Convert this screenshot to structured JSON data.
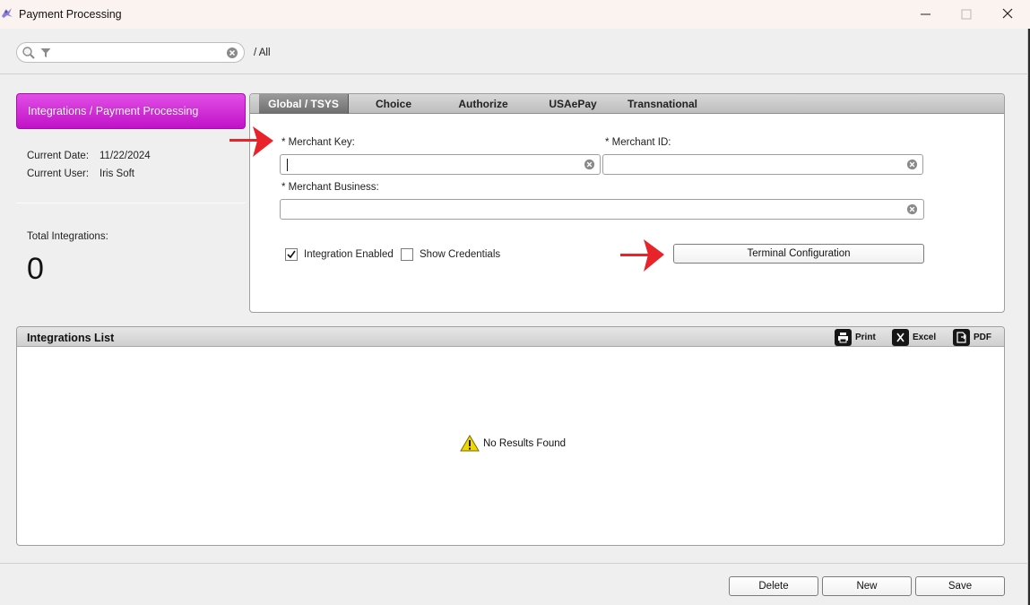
{
  "window": {
    "title": "Payment Processing",
    "controls": [
      "minimize-icon",
      "maximize-icon",
      "close-icon"
    ]
  },
  "search": {
    "value": "",
    "placeholder": "",
    "breadcrumb": "/ All",
    "icons": [
      "search-icon",
      "filter-icon",
      "clear-icon"
    ]
  },
  "sidebar": {
    "module_label": "Integrations / Payment Processing",
    "current_date_label": "Current Date:",
    "current_date": "11/22/2024",
    "current_user_label": "Current User:",
    "current_user": "Iris Soft",
    "total_label": "Total Integrations:",
    "total_value": "0"
  },
  "tabs": [
    {
      "label": "Global / TSYS",
      "active": true
    },
    {
      "label": "Choice",
      "active": false
    },
    {
      "label": "Authorize",
      "active": false
    },
    {
      "label": "USAePay",
      "active": false
    },
    {
      "label": "Transnational",
      "active": false
    }
  ],
  "form": {
    "merchant_key_label": "* Merchant Key:",
    "merchant_key_value": "",
    "merchant_id_label": "* Merchant ID:",
    "merchant_id_value": "",
    "merchant_business_label": "* Merchant Business:",
    "merchant_business_value": "",
    "integration_enabled_label": "Integration Enabled",
    "integration_enabled": true,
    "show_credentials_label": "Show Credentials",
    "show_credentials": false,
    "terminal_config_label": "Terminal Configuration"
  },
  "list": {
    "title": "Integrations List",
    "print_label": "Print",
    "excel_label": "Excel",
    "pdf_label": "PDF",
    "empty_message": "No Results Found",
    "empty_icon": "warning-icon"
  },
  "footer": {
    "delete_label": "Delete",
    "new_label": "New",
    "save_label": "Save"
  },
  "colors": {
    "module_accent": "#c012c8",
    "annotation_arrow": "#e8232a",
    "warning": "#f2d600"
  }
}
